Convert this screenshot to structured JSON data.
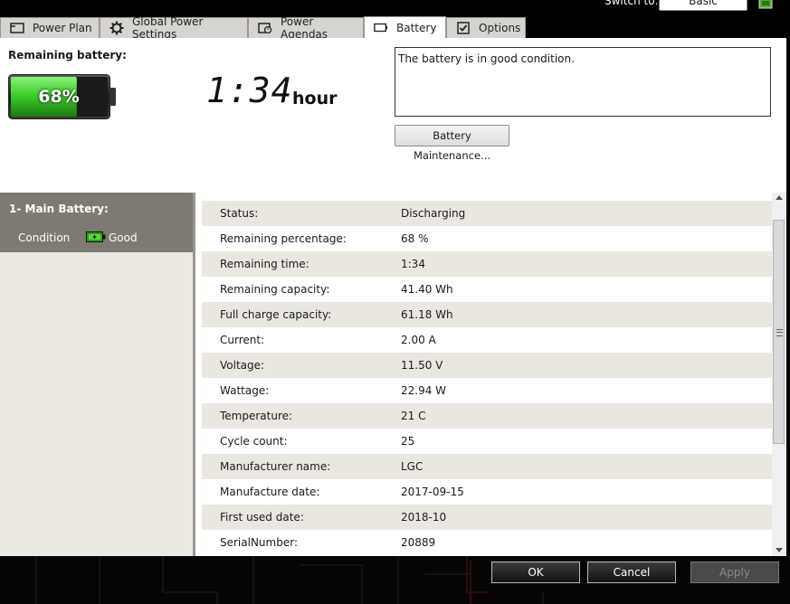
{
  "topbar": {
    "switch_label": "Switch to:",
    "switch_value": "Basic",
    "tabs": [
      {
        "label": "Power Plan",
        "icon": "power-plan-icon"
      },
      {
        "label": "Global Power Settings",
        "icon": "gear-icon"
      },
      {
        "label": "Power Agendas",
        "icon": "agenda-clock-icon"
      },
      {
        "label": "Battery",
        "icon": "battery-icon",
        "active": true
      },
      {
        "label": "Options",
        "icon": "checkbox-icon"
      }
    ]
  },
  "header": {
    "remaining_label": "Remaining battery:",
    "percent": "68%",
    "percent_value": 0.68,
    "time": "1:34",
    "time_unit": "hour",
    "message": "The battery is in good condition.",
    "maintenance_button": "Battery Maintenance..."
  },
  "left": {
    "title": "1- Main Battery:",
    "condition_label": "Condition",
    "condition_value": "Good"
  },
  "details": [
    {
      "label": "Status:",
      "value": "Discharging"
    },
    {
      "label": "Remaining percentage:",
      "value": "68 %"
    },
    {
      "label": "Remaining time:",
      "value": "1:34"
    },
    {
      "label": "Remaining capacity:",
      "value": "41.40 Wh"
    },
    {
      "label": "Full charge capacity:",
      "value": "61.18 Wh"
    },
    {
      "label": "Current:",
      "value": "2.00 A"
    },
    {
      "label": "Voltage:",
      "value": "11.50 V"
    },
    {
      "label": "Wattage:",
      "value": "22.94 W"
    },
    {
      "label": "Temperature:",
      "value": "21 C"
    },
    {
      "label": "Cycle count:",
      "value": "25"
    },
    {
      "label": "Manufacturer name:",
      "value": "LGC"
    },
    {
      "label": "Manufacture date:",
      "value": "2017-09-15"
    },
    {
      "label": "First used date:",
      "value": "2018-10"
    },
    {
      "label": "SerialNumber:",
      "value": "20889"
    }
  ],
  "footer": {
    "ok": "OK",
    "cancel": "Cancel",
    "apply": "Apply"
  },
  "colors": {
    "battery_fill": "#3dcf2a",
    "header_band": "#7d7a71",
    "row_alt": "#e9e7e0"
  }
}
